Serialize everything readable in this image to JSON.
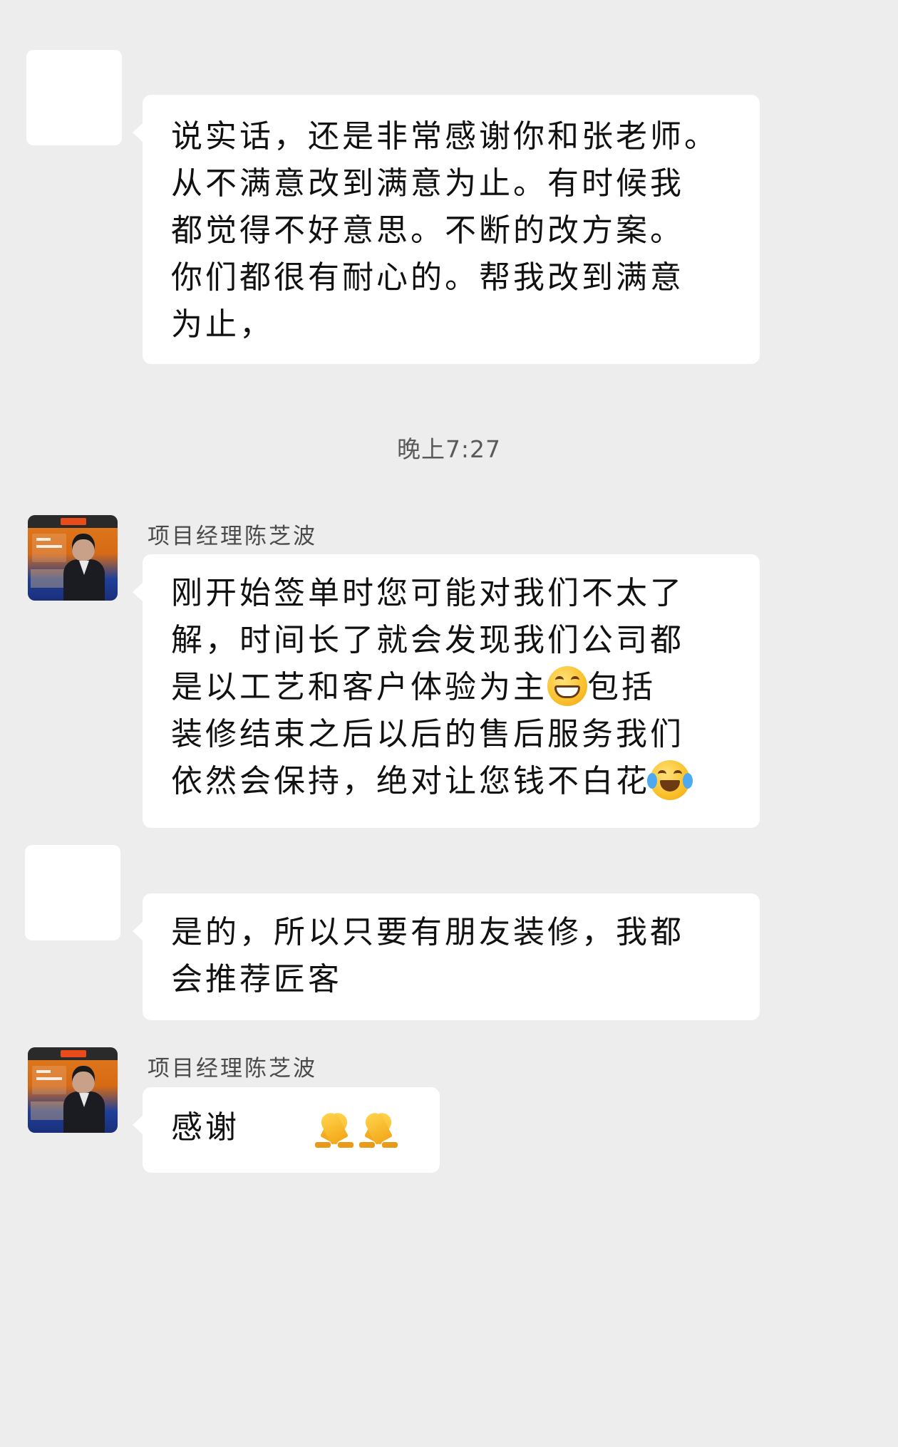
{
  "timestamp": "晚上7:27",
  "messages": [
    {
      "side": "customer",
      "lines": [
        "说实话，还是非常感谢你和张老师。",
        "从不满意改到满意为止。有时候我",
        "都觉得不好意思。不断的改方案。",
        "你们都很有耐心的。帮我改到满意",
        "为止，"
      ]
    },
    {
      "side": "manager",
      "sender": "项目经理陈芝波",
      "lines": [
        "刚开始签单时您可能对我们不太了",
        "解，时间长了就会发现我们公司都",
        "是以工艺和客户体验为主",
        "包括",
        "装修结束之后以后的售后服务我们",
        "依然会保持，绝对让您钱不白花"
      ],
      "emojis": [
        "grin-icon",
        "laugh-cry-icon"
      ]
    },
    {
      "side": "customer",
      "lines": [
        "是的，所以只要有朋友装修，我都",
        "会推荐匠客"
      ]
    },
    {
      "side": "manager",
      "sender": "项目经理陈芝波",
      "text": "感谢",
      "emojis": [
        "pray-icon",
        "pray-icon"
      ]
    }
  ]
}
